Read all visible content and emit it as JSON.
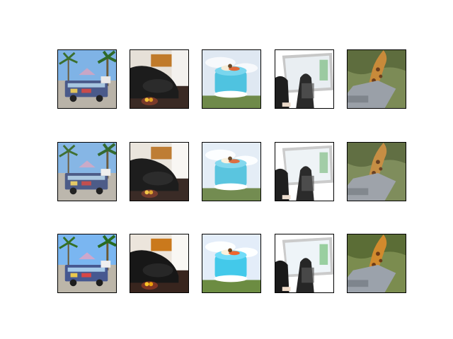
{
  "figure": {
    "rows": 3,
    "columns": 5,
    "columns_content": [
      "bus-scene-image",
      "kitchen-scene-image",
      "blue-cake-image",
      "laptop-desk-image",
      "giraffe-image"
    ]
  }
}
